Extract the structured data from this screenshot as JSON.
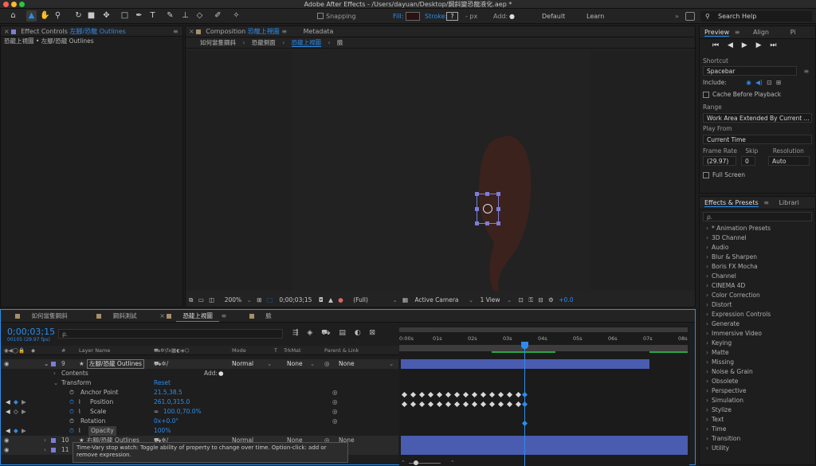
{
  "window": {
    "title": "Adobe After Effects - /Users/dayuan/Desktop/鋼斜變恐龍液化.aep *"
  },
  "toolbar": {
    "snapping": "Snapping",
    "fill": "Fill:",
    "stroke": "Stroke:",
    "stroke_q": "?",
    "px": "- px",
    "add": "Add:",
    "default": "Default",
    "learn": "Learn",
    "search": "Search Help"
  },
  "effect_controls": {
    "tab": "Effect Controls",
    "tab_layer": "左腳/恐龍 Outlines",
    "sub": "恐龍上視圖 • 左腳/恐龍 Outlines"
  },
  "composition": {
    "tab": "Composition",
    "tab_name": "恐龍上視圖",
    "metadata": "Metadata",
    "crumbs": [
      "如何當隻鋼斜",
      "恐龍側面",
      "恐龍上視圖",
      "臉"
    ],
    "zoom": "200%",
    "timecode": "0;00;03;15",
    "quality": "(Full)",
    "camera": "Active Camera",
    "view": "1 View",
    "exposure": "+0.0"
  },
  "preview": {
    "tabs": [
      "Preview",
      "Align",
      "Pi"
    ],
    "shortcut_label": "Shortcut",
    "shortcut": "Spacebar",
    "include": "Include:",
    "cache": "Cache Before Playback",
    "range_label": "Range",
    "range": "Work Area Extended By Current ...",
    "play_from_label": "Play From",
    "play_from": "Current Time",
    "frame_rate_label": "Frame Rate",
    "skip_label": "Skip",
    "res_label": "Resolution",
    "frame_rate": "(29.97)",
    "skip": "0",
    "resolution": "Auto",
    "full_screen": "Full Screen"
  },
  "effects": {
    "tab": "Effects & Presets",
    "tab2": "Librari",
    "search_ph": "ρ.",
    "items": [
      "* Animation Presets",
      "3D Channel",
      "Audio",
      "Blur & Sharpen",
      "Boris FX Mocha",
      "Channel",
      "CINEMA 4D",
      "Color Correction",
      "Distort",
      "Expression Controls",
      "Generate",
      "Immersive Video",
      "Keying",
      "Matte",
      "Missing",
      "Noise & Grain",
      "Obsolete",
      "Perspective",
      "Simulation",
      "Stylize",
      "Text",
      "Time",
      "Transition",
      "Utility"
    ]
  },
  "timeline": {
    "tabs": [
      "如何當隻鋼斜",
      "鋼斜測試",
      "恐龍上視圖",
      "臉"
    ],
    "timecode": "0;00;03;15",
    "frames": "00105 (29.97 fps)",
    "search_ph": "ρ.",
    "headers": {
      "num": "#",
      "layer": "Layer Name",
      "mode": "Mode",
      "t": "T",
      "trkmat": "TrkMat",
      "parent": "Parent & Link"
    },
    "ruler": [
      "0:00s",
      "01s",
      "02s",
      "03s",
      "04s",
      "05s",
      "06s",
      "07s",
      "08s"
    ],
    "layer9": {
      "num": "9",
      "name": "左腳/恐龍 Outlines",
      "mode": "Normal",
      "trk": "None",
      "parent": "None"
    },
    "contents": "Contents",
    "add": "Add:",
    "transform": "Transform",
    "reset": "Reset",
    "props": [
      {
        "name": "Anchor Point",
        "value": "21.5,38.5"
      },
      {
        "name": "Position",
        "value": "261.0,315.0"
      },
      {
        "name": "Scale",
        "value": "100.0,70.0%"
      },
      {
        "name": "Rotation",
        "value": "0x+0.0°"
      },
      {
        "name": "Opacity",
        "value": "100%"
      }
    ],
    "layer10": {
      "num": "10",
      "name": "右腳/恐龍 Outlines",
      "mode": "Normal",
      "trk": "None",
      "parent": "None"
    },
    "layer11": {
      "num": "11"
    },
    "tooltip": "Time-Vary stop watch: Toggle ability of property to change over time. Option-click: add or remove expression."
  },
  "colors": {
    "accent": "#2d8ceb",
    "label": "#7d7dd8",
    "dino": "#3b221d"
  }
}
